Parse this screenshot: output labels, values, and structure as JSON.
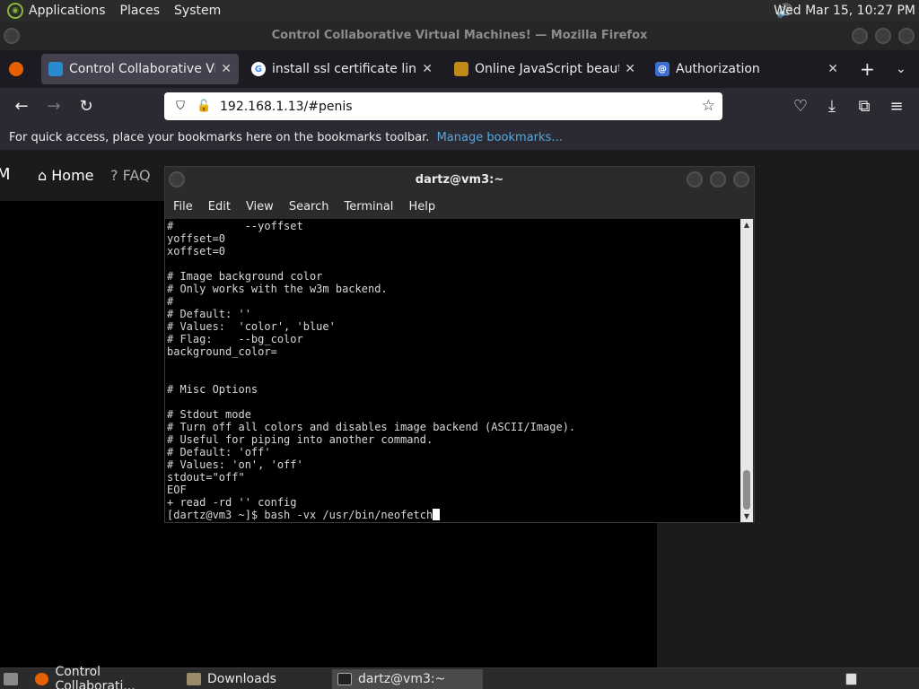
{
  "top_panel": {
    "menus": [
      "Applications",
      "Places",
      "System"
    ],
    "clock": "Wed Mar 15, 10:27 PM"
  },
  "firefox": {
    "window_title": "Control Collaborative Virtual Machines! — Mozilla Firefox",
    "tabs": [
      {
        "label": "Control Collaborative Virtua",
        "active": true
      },
      {
        "label": "install ssl certificate linux - G",
        "active": false
      },
      {
        "label": "Online JavaScript beautifier",
        "active": false
      },
      {
        "label": "Authorization",
        "active": false
      }
    ],
    "url": "192.168.1.13/#penis",
    "bookmarks_text": "For quick access, place your bookmarks here on the bookmarks toolbar.",
    "bookmarks_link": "Manage bookmarks…"
  },
  "page": {
    "nav": [
      "M",
      "Home",
      "FAQ"
    ]
  },
  "terminal": {
    "title": "dartz@vm3:~",
    "menu": [
      "File",
      "Edit",
      "View",
      "Search",
      "Terminal",
      "Help"
    ],
    "lines": [
      "#           --yoffset",
      "yoffset=0",
      "xoffset=0",
      "",
      "# Image background color",
      "# Only works with the w3m backend.",
      "#",
      "# Default: ''",
      "# Values:  'color', 'blue'",
      "# Flag:    --bg_color",
      "background_color=",
      "",
      "",
      "# Misc Options",
      "",
      "# Stdout mode",
      "# Turn off all colors and disables image backend (ASCII/Image).",
      "# Useful for piping into another command.",
      "# Default: 'off'",
      "# Values: 'on', 'off'",
      "stdout=\"off\"",
      "EOF",
      "+ read -rd '' config"
    ],
    "prompt": "[dartz@vm3 ~]$ bash -vx /usr/bin/neofetch"
  },
  "taskbar": {
    "items": [
      "Control Collaborati...",
      "Downloads",
      "dartz@vm3:~"
    ]
  }
}
